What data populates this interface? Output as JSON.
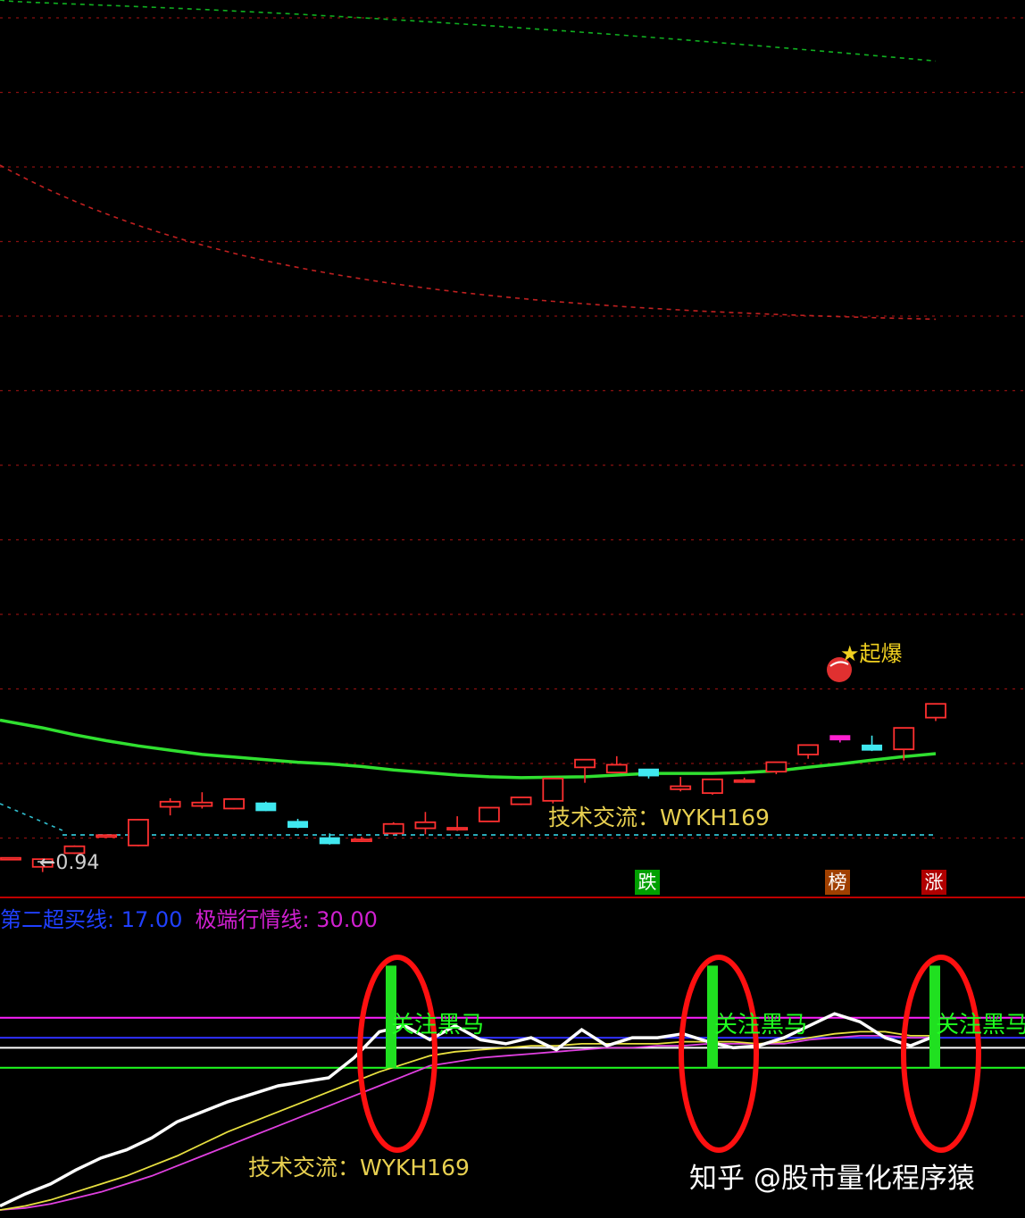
{
  "chart_data": [
    {
      "type": "candlestick",
      "panel": "main",
      "candles": [
        {
          "o": 1.09,
          "h": 1.11,
          "l": 1.08,
          "c": 1.105
        },
        {
          "o": 1.0,
          "h": 1.1,
          "l": 0.94,
          "c": 1.09
        },
        {
          "o": 1.16,
          "h": 1.25,
          "l": 1.15,
          "c": 1.24
        },
        {
          "o": 1.36,
          "h": 1.38,
          "l": 1.345,
          "c": 1.37
        },
        {
          "o": 1.25,
          "h": 1.56,
          "l": 1.24,
          "c": 1.55
        },
        {
          "o": 1.7,
          "h": 1.8,
          "l": 1.6,
          "c": 1.76
        },
        {
          "o": 1.71,
          "h": 1.87,
          "l": 1.68,
          "c": 1.75
        },
        {
          "o": 1.68,
          "h": 1.8,
          "l": 1.67,
          "c": 1.79
        },
        {
          "o": 1.745,
          "h": 1.76,
          "l": 1.65,
          "c": 1.655
        },
        {
          "o": 1.53,
          "h": 1.56,
          "l": 1.45,
          "c": 1.46
        },
        {
          "o": 1.34,
          "h": 1.39,
          "l": 1.26,
          "c": 1.27
        },
        {
          "o": 1.31,
          "h": 1.35,
          "l": 1.29,
          "c": 1.32
        },
        {
          "o": 1.39,
          "h": 1.52,
          "l": 1.375,
          "c": 1.5
        },
        {
          "o": 1.45,
          "h": 1.64,
          "l": 1.38,
          "c": 1.52
        },
        {
          "o": 1.445,
          "h": 1.59,
          "l": 1.42,
          "c": 1.455
        },
        {
          "o": 1.53,
          "h": 1.62,
          "l": 1.525,
          "c": 1.69
        },
        {
          "o": 1.73,
          "h": 1.74,
          "l": 1.72,
          "c": 1.81
        },
        {
          "o": 1.77,
          "h": 1.78,
          "l": 1.74,
          "c": 2.03
        },
        {
          "o": 2.16,
          "h": 2.19,
          "l": 1.98,
          "c": 2.25
        },
        {
          "o": 2.1,
          "h": 2.29,
          "l": 2.09,
          "c": 2.19
        },
        {
          "o": 2.14,
          "h": 2.14,
          "l": 2.03,
          "c": 2.06
        },
        {
          "o": 1.905,
          "h": 2.05,
          "l": 1.88,
          "c": 1.94
        },
        {
          "o": 1.86,
          "h": 1.85,
          "l": 1.84,
          "c": 2.02
        },
        {
          "o": 1.99,
          "h": 2.04,
          "l": 1.98,
          "c": 2.01
        },
        {
          "o": 2.11,
          "h": 2.14,
          "l": 2.08,
          "c": 2.22
        },
        {
          "o": 2.31,
          "h": 2.34,
          "l": 2.26,
          "c": 2.42
        },
        {
          "o": 2.48,
          "h": 2.49,
          "l": 2.45,
          "c": 2.53
        },
        {
          "o": 2.42,
          "h": 2.53,
          "l": 2.35,
          "c": 2.36
        },
        {
          "o": 2.37,
          "h": 2.54,
          "l": 2.24,
          "c": 2.62
        },
        {
          "o": 2.74,
          "h": 2.76,
          "l": 2.7,
          "c": 2.9
        }
      ],
      "ma_green": [
        2.71,
        2.62,
        2.54,
        2.47,
        2.41,
        2.36,
        2.31,
        2.28,
        2.25,
        2.22,
        2.2,
        2.17,
        2.13,
        2.1,
        2.07,
        2.05,
        2.04,
        2.045,
        2.05,
        2.07,
        2.09,
        2.09,
        2.09,
        2.1,
        2.12,
        2.16,
        2.2,
        2.245,
        2.285,
        2.32
      ],
      "min_label": "←0.94",
      "watermark": "技术交流：WYKH169",
      "signal_text": "★起爆",
      "ylim": [
        0.8,
        11.0
      ]
    },
    {
      "type": "line",
      "panel": "indicator",
      "legend": [
        {
          "name": "第二超买线",
          "value": "17.00"
        },
        {
          "name": "极端行情线",
          "value": "30.00"
        }
      ],
      "series": [
        {
          "name": "white",
          "values": [
            -4,
            2,
            7,
            14,
            20,
            24,
            30,
            38,
            43,
            48,
            52,
            56,
            58,
            60,
            70,
            83,
            86,
            79,
            86,
            79,
            77,
            80,
            74,
            84,
            76,
            80,
            80,
            82,
            78,
            75,
            76,
            80,
            86,
            92,
            88,
            80,
            76,
            81
          ]
        },
        {
          "name": "yellow",
          "values": [
            -6,
            -4,
            -1,
            3,
            7,
            11,
            16,
            21,
            27,
            33,
            38,
            43,
            48,
            53,
            58,
            63,
            67,
            71,
            73,
            74,
            75,
            76,
            76,
            77,
            77,
            77,
            77,
            78,
            78,
            78,
            77,
            78,
            80,
            82,
            83,
            83,
            81,
            81
          ]
        },
        {
          "name": "magenta",
          "values": [
            -6,
            -5,
            -3,
            0,
            3,
            7,
            11,
            16,
            21,
            26,
            31,
            36,
            41,
            46,
            51,
            56,
            61,
            66,
            68,
            70,
            71,
            72,
            73,
            74,
            75,
            75,
            76,
            76,
            77,
            77,
            77,
            77,
            79,
            80,
            81,
            81,
            80,
            80
          ]
        }
      ],
      "hlines": [
        {
          "value": 90,
          "color": "#ff20ff"
        },
        {
          "value": 80,
          "color": "#3030ff"
        },
        {
          "value": 75,
          "color": "#ffffff"
        },
        {
          "value": 65,
          "color": "#20ff20"
        }
      ],
      "signals": [
        {
          "label": "关注黑马"
        },
        {
          "label": "关注黑马"
        },
        {
          "label": "关注黑马"
        }
      ],
      "tags": [
        {
          "label": "跌",
          "color": "#00a000"
        },
        {
          "label": "榜",
          "color": "#a04000"
        },
        {
          "label": "涨",
          "color": "#b00000"
        }
      ],
      "watermark": "技术交流：WYKH169",
      "ylim": [
        -10,
        130
      ]
    }
  ],
  "footer": {
    "brand": "知乎 @股市量化程序猿"
  }
}
